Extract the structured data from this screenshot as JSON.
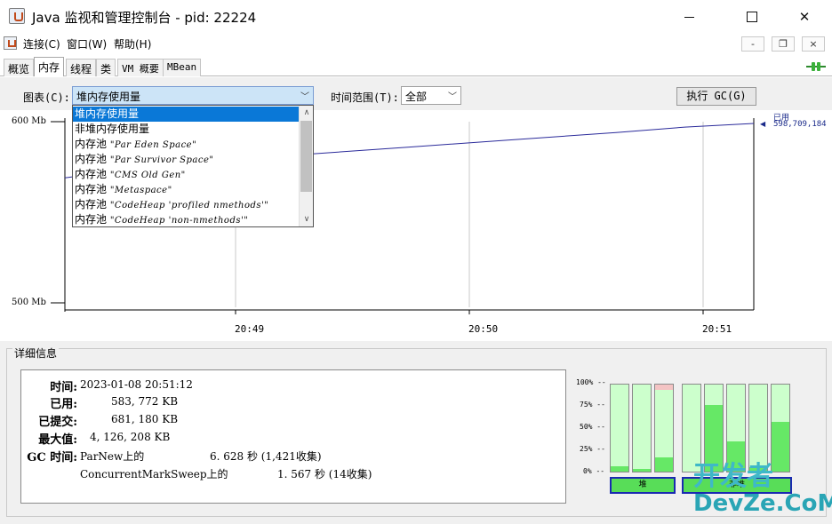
{
  "window": {
    "title": "Java 监视和管理控制台 - pid: 22224"
  },
  "menu": {
    "items": [
      "连接(C)",
      "窗口(W)",
      "帮助(H)"
    ]
  },
  "mdi": {
    "min": "-",
    "restore": "❐",
    "close": "×"
  },
  "tabs": [
    "概览",
    "内存",
    "线程",
    "类",
    "VM 概要",
    "MBean"
  ],
  "active_tab": "内存",
  "controls": {
    "chart_label": "图表(C):",
    "chart_value": "堆内存使用量",
    "time_label": "时间范围(T):",
    "time_value": "全部",
    "gc_button": "执行 GC(G)"
  },
  "dropdown": {
    "items": [
      {
        "prefix": "堆内存使用量",
        "pool": ""
      },
      {
        "prefix": "非堆内存使用量",
        "pool": ""
      },
      {
        "prefix": "内存池 ",
        "pool": "\"Par Eden Space\""
      },
      {
        "prefix": "内存池 ",
        "pool": "\"Par Survivor Space\""
      },
      {
        "prefix": "内存池 ",
        "pool": "\"CMS Old Gen\""
      },
      {
        "prefix": "内存池 ",
        "pool": "\"Metaspace\""
      },
      {
        "prefix": "内存池 ",
        "pool": "\"CodeHeap 'profiled nmethods'\""
      },
      {
        "prefix": "内存池 ",
        "pool": "\"CodeHeap 'non-nmethods'\""
      }
    ],
    "selected_index": 0
  },
  "chart_data": {
    "type": "line",
    "y_tick_labels": [
      "600 Mb",
      "500 Mb"
    ],
    "x_tick_labels": [
      "20:49",
      "20:50",
      "20:51"
    ],
    "ylim": [
      500,
      600
    ],
    "series": [
      {
        "name": "已用",
        "color": "#2a2a9a",
        "last_value": "598,709,184",
        "x": [
          0.0,
          0.1,
          0.2,
          0.35,
          0.5,
          0.65,
          0.8,
          0.9,
          1.0
        ],
        "y": [
          569,
          574,
          578,
          582,
          586,
          590,
          594,
          597,
          599
        ]
      }
    ],
    "grid": true
  },
  "details": {
    "title": "详细信息",
    "rows": [
      {
        "key": "时间:",
        "value": "2023-01-08 20:51:12"
      },
      {
        "key": "已用:",
        "value": "583, 772 KB"
      },
      {
        "key": "已提交:",
        "value": "681, 180 KB"
      },
      {
        "key": "最大值:",
        "value": "4, 126, 208 KB"
      },
      {
        "key": "GC 时间:",
        "value": "ParNew上的"
      }
    ],
    "gc": [
      {
        "name": "ParNew上的",
        "time": "6. 628 秒 (1,421收集)"
      },
      {
        "name": "ConcurrentMarkSweep上的",
        "time": "1. 567 秒 (14收集)"
      }
    ]
  },
  "usage_bars": {
    "pct_labels": [
      "100% --",
      "75% --",
      "50% --",
      "25% --",
      "0% --"
    ],
    "heap_label": "堆",
    "nonheap_label": "非堆",
    "heap": [
      {
        "used": 0.06,
        "top": 0.0
      },
      {
        "used": 0.03,
        "top": 0.0
      },
      {
        "used": 0.16,
        "top": 0.06
      }
    ],
    "nonheap": [
      {
        "used": 0.0,
        "top": 0.0
      },
      {
        "used": 0.77,
        "top": 0.0
      },
      {
        "used": 0.35,
        "top": 0.0
      },
      {
        "used": 0.05,
        "top": 0.0
      },
      {
        "used": 0.57,
        "top": 0.0
      }
    ]
  },
  "watermark": {
    "line1": "开发者",
    "line2": "DevZe.CoM"
  }
}
